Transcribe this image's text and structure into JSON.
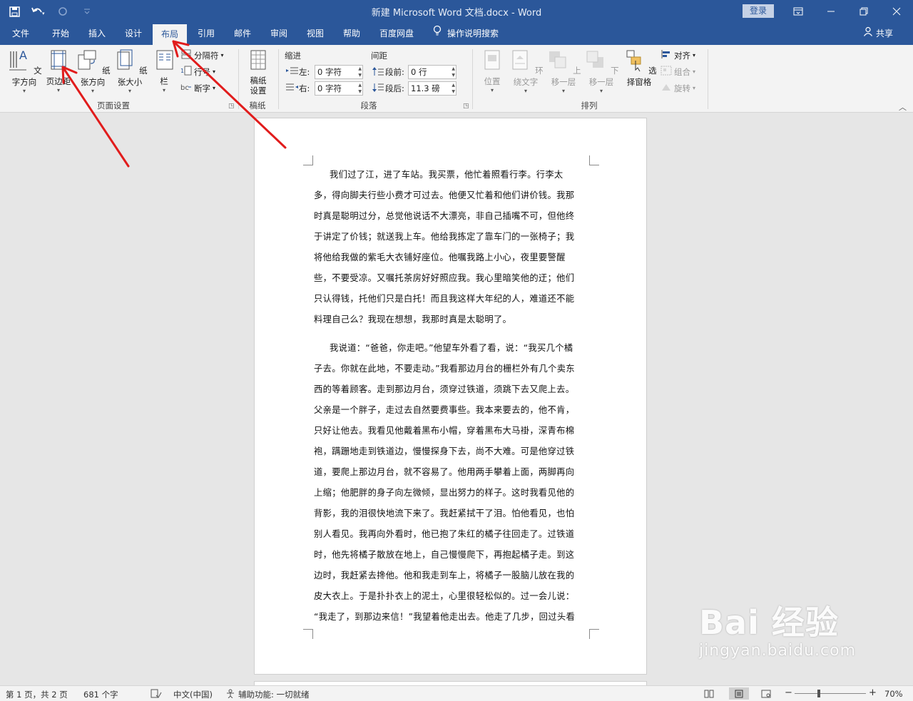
{
  "window": {
    "title": "新建 Microsoft Word 文档.docx  -  Word",
    "login": "登录",
    "controls": [
      "restore-ribbon",
      "minimize",
      "maximize",
      "close"
    ]
  },
  "tabs": [
    {
      "label": "文件"
    },
    {
      "label": "开始"
    },
    {
      "label": "插入"
    },
    {
      "label": "设计"
    },
    {
      "label": "布局",
      "active": true
    },
    {
      "label": "引用"
    },
    {
      "label": "邮件"
    },
    {
      "label": "审阅"
    },
    {
      "label": "视图"
    },
    {
      "label": "帮助"
    },
    {
      "label": "百度网盘"
    }
  ],
  "tell_me": "操作说明搜索",
  "share": "共享",
  "ribbon": {
    "page_setup": {
      "label": "页面设置",
      "text_direction": "文字方向",
      "margins": "页边距",
      "orientation": "纸张方向",
      "size": "纸张大小",
      "columns": "栏",
      "breaks": "分隔符",
      "line_numbers": "行号",
      "hyphenation": "断字"
    },
    "manuscript": {
      "label": "稿纸",
      "settings_line1": "稿纸",
      "settings_line2": "设置"
    },
    "paragraph": {
      "label": "段落",
      "indent_title": "缩进",
      "spacing_title": "间距",
      "left_label": "左:",
      "left_value": "0 字符",
      "right_label": "右:",
      "right_value": "0 字符",
      "before_label": "段前:",
      "before_value": "0 行",
      "after_label": "段后:",
      "after_value": "11.3 磅"
    },
    "arrange": {
      "label": "排列",
      "position": "位置",
      "wrap_text": "环绕文字",
      "bring_forward": "上移一层",
      "send_backward": "下移一层",
      "selection_pane": "选择窗格",
      "align": "对齐",
      "group": "组合",
      "rotate": "旋转"
    }
  },
  "document": {
    "paragraph1": [
      "我们过了江，进了车站。我买票，他忙着照看行李。行李太",
      "多，得向脚夫行些小费才可过去。他便又忙着和他们讲价钱。我那",
      "时真是聪明过分，总觉他说话不大漂亮，非自己插嘴不可，但他终",
      "于讲定了价钱；就送我上车。他给我拣定了靠车门的一张椅子；我",
      "将他给我做的紫毛大衣铺好座位。他嘱我路上小心，夜里要警醒",
      "些，不要受凉。又嘱托茶房好好照应我。我心里暗笑他的迂；他们",
      "只认得钱，托他们只是白托！而且我这样大年纪的人，难道还不能",
      "料理自己么？我现在想想，我那时真是太聪明了。"
    ],
    "paragraph2": [
      "我说道：“爸爸，你走吧。”他望车外看了看，说：“我买几个橘",
      "子去。你就在此地，不要走动。”我看那边月台的栅栏外有几个卖东",
      "西的等着顾客。走到那边月台，须穿过铁道，须跳下去又爬上去。",
      "父亲是一个胖子，走过去自然要费事些。我本来要去的，他不肯，",
      "只好让他去。我看见他戴着黑布小帽，穿着黑布大马褂，深青布棉",
      "袍，蹒跚地走到铁道边，慢慢探身下去，尚不大难。可是他穿过铁",
      "道，要爬上那边月台，就不容易了。他用两手攀着上面，两脚再向",
      "上缩；他肥胖的身子向左微倾，显出努力的样子。这时我看见他的",
      "背影，我的泪很快地流下来了。我赶紧拭干了泪。怕他看见，也怕",
      "别人看见。我再向外看时，他已抱了朱红的橘子往回走了。过铁道",
      "时，他先将橘子散放在地上，自己慢慢爬下，再抱起橘子走。到这",
      "边时，我赶紧去搀他。他和我走到车上，将橘子一股脑儿放在我的",
      "皮大衣上。于是扑扑衣上的泥土，心里很轻松似的。过一会儿说：",
      "“我走了，到那边来信！”我望着他走出去。他走了几步，回过头看"
    ]
  },
  "status": {
    "page": "第 1 页，共 2 页",
    "words": "681 个字",
    "language": "中文(中国)",
    "accessibility": "辅助功能: 一切就绪",
    "zoom": "70%",
    "zoom_minus": "−",
    "zoom_plus": "+"
  },
  "watermark": {
    "brand": "Bai  经验",
    "url": "jingyan.baidu.com"
  },
  "colors": {
    "title_bar": "#2b579a",
    "ribbon": "#f3f3f3",
    "annotation_arrow": "#e11c1c"
  }
}
